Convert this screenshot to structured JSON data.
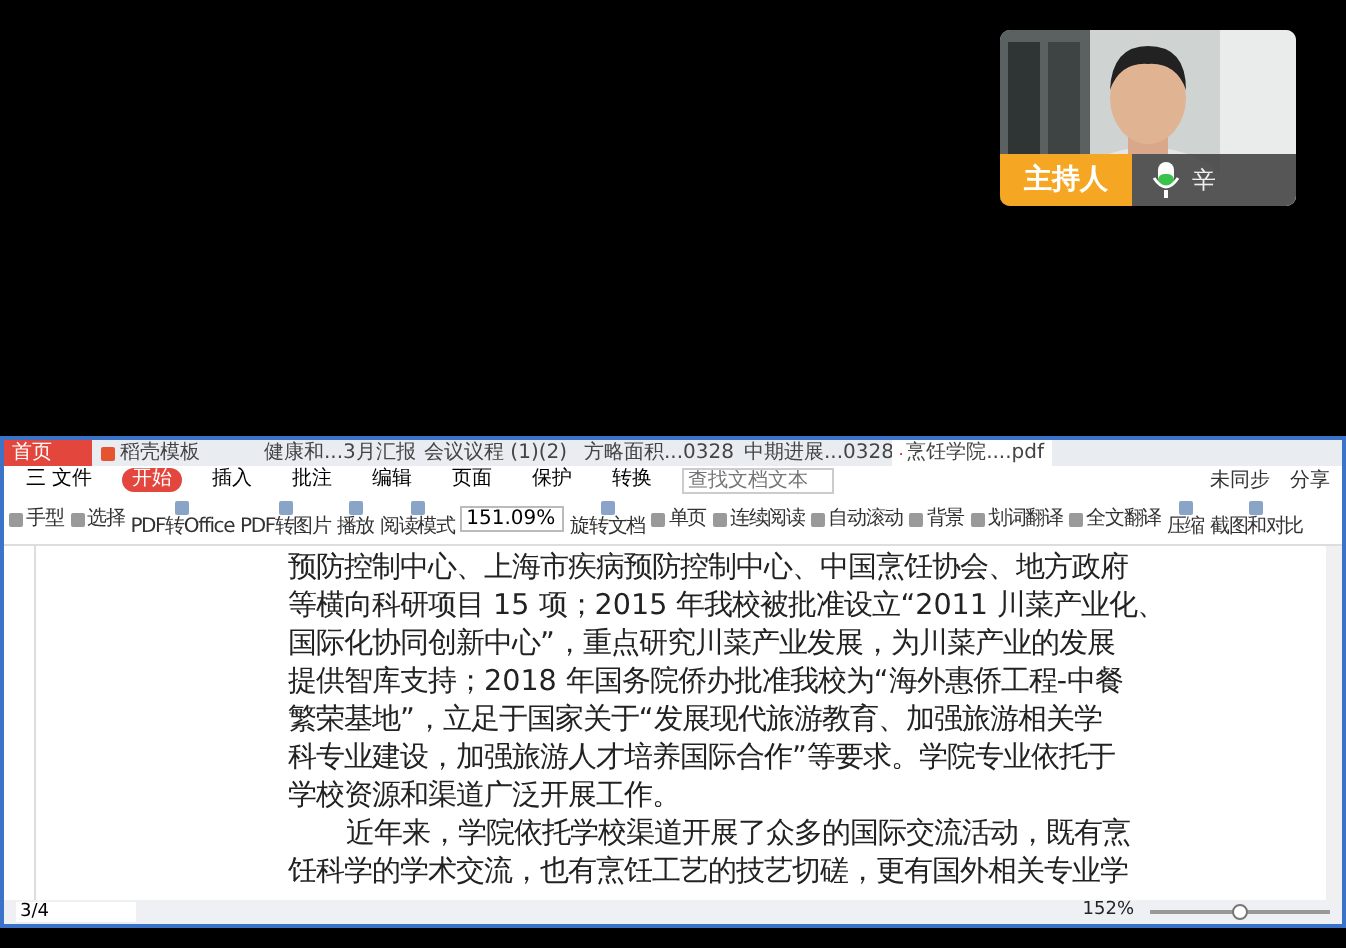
{
  "video": {
    "role_badge": "主持人",
    "mic_on": true,
    "name": "辛"
  },
  "app": {
    "tabs": [
      {
        "label": "首页",
        "kind": "home",
        "selected": false
      },
      {
        "label": "稻壳模板",
        "kind": "shop",
        "selected": false
      },
      {
        "label": "健康和...3月汇报",
        "kind": "ppt",
        "selected": false
      },
      {
        "label": "会议议程 (1)(2)",
        "kind": "doc",
        "selected": false
      },
      {
        "label": "方略面积...0328",
        "kind": "doc",
        "selected": false
      },
      {
        "label": "中期进展...0328",
        "kind": "doc",
        "selected": false
      },
      {
        "label": "烹饪学院....pdf",
        "kind": "pdf",
        "selected": true
      }
    ],
    "menu": [
      {
        "label": "三 文件",
        "selected": false
      },
      {
        "label": "开始",
        "selected": true
      },
      {
        "label": "插入",
        "selected": false
      },
      {
        "label": "批注",
        "selected": false
      },
      {
        "label": "编辑",
        "selected": false
      },
      {
        "label": "页面",
        "selected": false
      },
      {
        "label": "保护",
        "selected": false
      },
      {
        "label": "转换",
        "selected": false
      }
    ],
    "search": {
      "placeholder": "查找文档文本"
    },
    "sync": [
      "未同步",
      "分享"
    ],
    "toolbar": [
      {
        "label": "手型",
        "kind": "small"
      },
      {
        "label": "选择",
        "kind": "small"
      },
      {
        "label": "PDF转Office",
        "kind": "big"
      },
      {
        "label": "PDF转图片",
        "kind": "big"
      },
      {
        "label": "播放",
        "kind": "big"
      },
      {
        "label": "阅读模式",
        "kind": "big"
      },
      {
        "label": "151.09%",
        "kind": "zoom"
      },
      {
        "label": "旋转文档",
        "kind": "big"
      },
      {
        "label": "单页",
        "kind": "small"
      },
      {
        "label": "连续阅读",
        "kind": "small"
      },
      {
        "label": "自动滚动",
        "kind": "small"
      },
      {
        "label": "背景",
        "kind": "small"
      },
      {
        "label": "划词翻译",
        "kind": "small"
      },
      {
        "label": "全文翻译",
        "kind": "small"
      },
      {
        "label": "压缩",
        "kind": "big"
      },
      {
        "label": "截图和对比",
        "kind": "big"
      }
    ],
    "document": [
      {
        "kind": "line",
        "text": "预防控制中心、上海市疾病预防控制中心、中国烹饪协会、地方政府"
      },
      {
        "kind": "line",
        "text": "等横向科研项目 15 项；2015 年我校被批准设立“2011 川菜产业化、"
      },
      {
        "kind": "line",
        "text": "国际化协同创新中心”，重点研究川菜产业发展，为川菜产业的发展"
      },
      {
        "kind": "line",
        "text": "提供智库支持；2018 年国务院侨办批准我校为“海外惠侨工程-中餐"
      },
      {
        "kind": "line",
        "text": "繁荣基地”，立足于国家关于“发展现代旅游教育、加强旅游相关学"
      },
      {
        "kind": "line",
        "text": "科专业建设，加强旅游人才培养国际合作”等要求。学院专业依托于"
      },
      {
        "kind": "line",
        "text": "学校资源和渠道广泛开展工作。"
      },
      {
        "kind": "indent",
        "text": "近年来，学院依托学校渠道开展了众多的国际交流活动，既有烹"
      },
      {
        "kind": "line",
        "text": "饪科学的学术交流，也有烹饪工艺的技艺切磋，更有国外相关专业学"
      }
    ],
    "status": {
      "page": "3/4",
      "zoom": "152%",
      "level": 0.5
    }
  }
}
